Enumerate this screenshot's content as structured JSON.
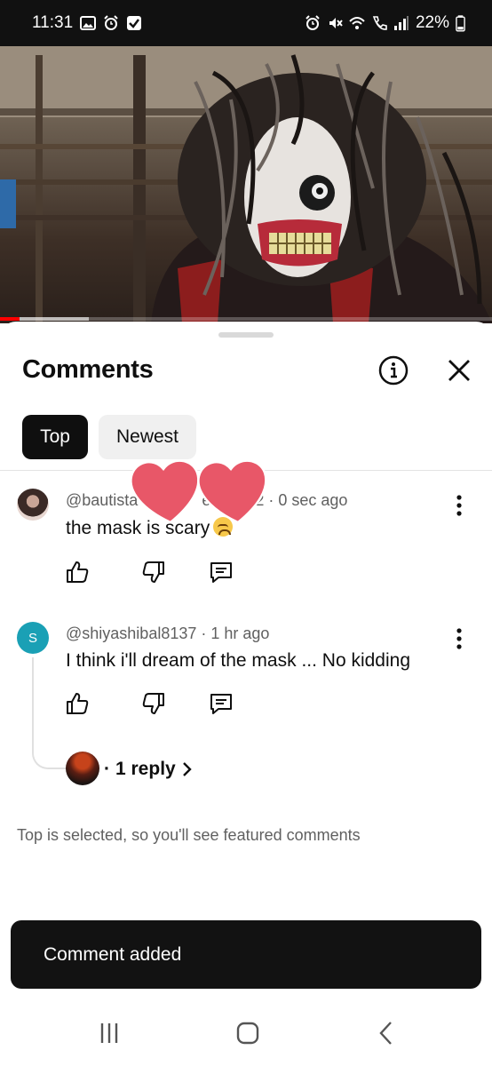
{
  "status_bar": {
    "time": "11:31",
    "battery": "22%",
    "left_icons": [
      "gallery-icon",
      "alarm-icon",
      "checkbox-icon"
    ],
    "right_icons": [
      "alarm-icon",
      "mute-icon",
      "wifi-icon",
      "call-icon",
      "signal-icon",
      "battery-icon"
    ]
  },
  "video": {
    "progress_fraction": 0.04,
    "buffered_fraction": 0.18,
    "accent_color": "#ff0000"
  },
  "comments_sheet": {
    "title": "Comments",
    "info_icon": "info-icon",
    "close_icon": "close-icon",
    "tabs": [
      {
        "label": "Top",
        "selected": true
      },
      {
        "label": "Newest",
        "selected": false
      }
    ],
    "comments": [
      {
        "author": "@bautista",
        "author_suffix": "ea",
        "author_tail": "2 · 0 sec ago",
        "text": "the mask is scary",
        "emoji": "worried-face-emoji"
      },
      {
        "avatar_letter": "S",
        "author": "@shiyashibal8137 · 1 hr ago",
        "text": "I think i'll dream of the mask ... No kidding",
        "replies": {
          "label": "1 reply"
        }
      }
    ],
    "footnote": "Top is selected, so you'll see featured comments"
  },
  "toast": {
    "message": "Comment added"
  },
  "navigation": {
    "buttons": [
      "recent-apps-icon",
      "home-icon",
      "back-icon"
    ]
  }
}
